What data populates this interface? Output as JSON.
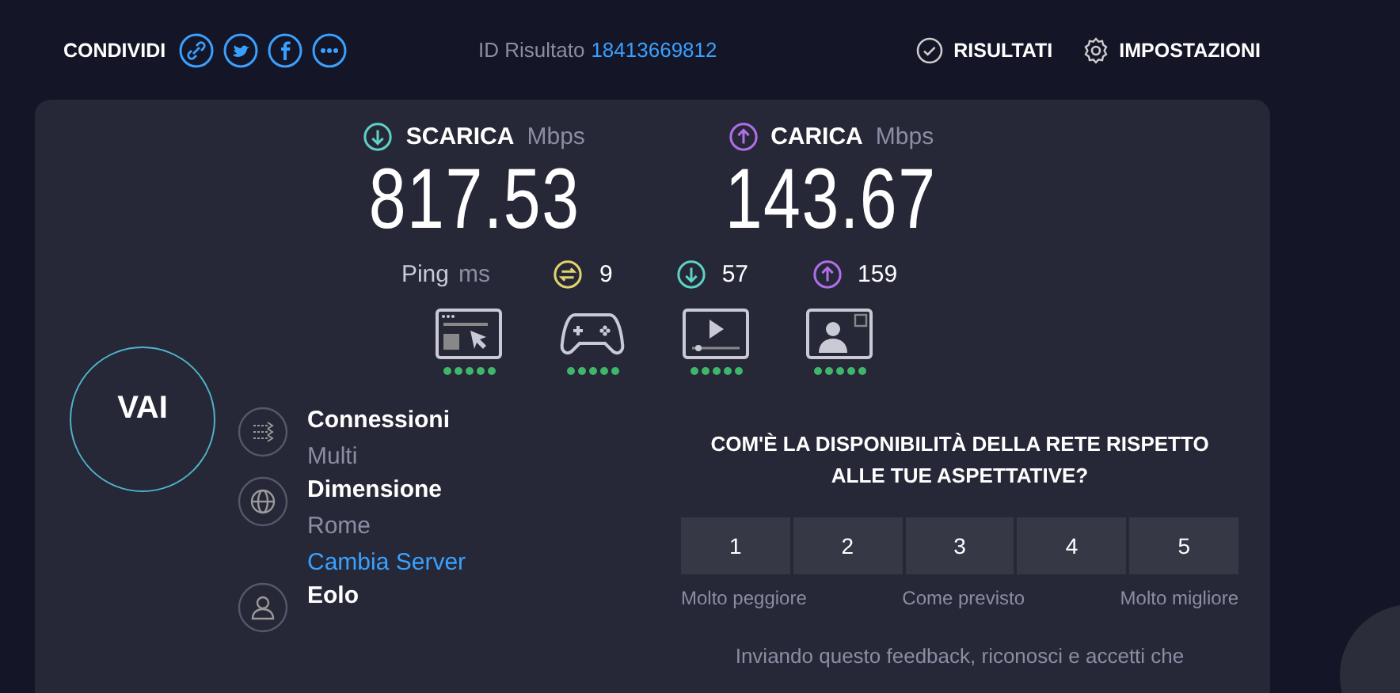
{
  "header": {
    "share_label": "CONDIVIDI",
    "result_id_label": "ID Risultato",
    "result_id": "18413669812",
    "nav": [
      {
        "kind": "results",
        "label": "RISULTATI"
      },
      {
        "kind": "settings",
        "label": "IMPOSTAZIONI"
      }
    ]
  },
  "speeds": [
    {
      "kind": "download",
      "label": "SCARICA",
      "unit": "Mbps",
      "value": "817.53"
    },
    {
      "kind": "upload",
      "label": "CARICA",
      "unit": "Mbps",
      "value": "143.67"
    }
  ],
  "ping": {
    "label": "Ping",
    "unit": "ms",
    "readings": [
      {
        "kind": "idle",
        "value": "9"
      },
      {
        "kind": "download",
        "value": "57"
      },
      {
        "kind": "upload",
        "value": "159"
      }
    ]
  },
  "quality": [
    {
      "kind": "browsing",
      "stars": 5
    },
    {
      "kind": "gaming",
      "stars": 5
    },
    {
      "kind": "video",
      "stars": 5
    },
    {
      "kind": "calls",
      "stars": 5
    }
  ],
  "go_button": "VAI",
  "details": [
    {
      "kind": "connections",
      "title": "Connessioni",
      "value": "Multi"
    },
    {
      "kind": "server",
      "title": "Dimensione",
      "value": "Rome",
      "link": "Cambia Server"
    },
    {
      "kind": "provider",
      "title": "Eolo"
    }
  ],
  "survey": {
    "question": "COM'È LA DISPONIBILITÀ DELLA RETE RISPETTO ALLE TUE ASPETTATIVE?",
    "options": [
      {
        "label": "1",
        "selected": false
      },
      {
        "label": "2",
        "selected": false
      },
      {
        "label": "3",
        "selected": false
      },
      {
        "label": "4",
        "selected": false
      },
      {
        "label": "5",
        "selected": false
      }
    ],
    "scale_labels": [
      "Molto peggiore",
      "Come previsto",
      "Molto migliore"
    ],
    "note": "Inviando questo feedback, riconosci e accetti che"
  }
}
